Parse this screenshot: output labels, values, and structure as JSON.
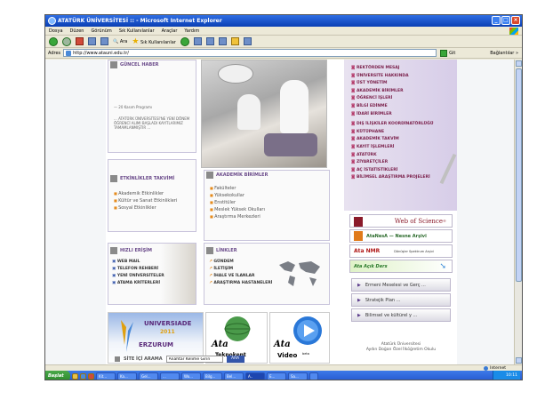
{
  "window": {
    "title": "ATATÜRK ÜNİVERSİTESİ :: - Microsoft Internet Explorer"
  },
  "menubar": {
    "items": [
      "Dosya",
      "Düzen",
      "Görünüm",
      "Sık Kullanılanlar",
      "Araçlar",
      "Yardım"
    ]
  },
  "toolbar": {
    "search_label": "Ara",
    "favorites_label": "Sık Kullanılanlar"
  },
  "addressbar": {
    "label": "Adres",
    "url": "http://www.atauni.edu.tr/",
    "go_label": "Git",
    "links_label": "Bağlantılar »"
  },
  "page": {
    "guncel": {
      "title": "GÜNCEL HABER",
      "news_text_1": "— 20 Kasım Programı",
      "news_text_2": "... ATATÜRK ÜNİVERSİTESİ'NE YENİ DÖNEM ÖĞRENCİ ALIMI BAŞLADI KAYITLARIMIZ TAMAMLANMIŞTIR ..."
    },
    "etkinlikler": {
      "title": "ETKİNLİKLER TAKVİMİ",
      "items": [
        "Akademik Etkinlikler",
        "Kültür ve Sanat Etkinlikleri",
        "Sosyal Etkinlikler"
      ]
    },
    "akademik": {
      "title": "AKADEMİK BİRİMLER",
      "items": [
        "Fakülteler",
        "Yüksekokullar",
        "Enstitüler",
        "Meslek Yüksek Okulları",
        "Araştırma Merkezleri"
      ]
    },
    "hizli": {
      "title": "HIZLI ERİŞİM",
      "items": [
        "WEB MAIL",
        "TELEFON REHBERİ",
        "YENİ ÜNİVERSİTELER",
        "ATAMA KRİTERLERİ"
      ]
    },
    "linkler": {
      "title": "LİNKLER",
      "items": [
        "GÜNDEM",
        "İLETİŞİM",
        "İHALE VE İLANLAR",
        "ARAŞTIRMA HASTANELERİ"
      ]
    },
    "rightmenu": {
      "items": [
        "REKTÖRDEN MESAJ",
        "ÜNİVERSİTE HAKKINDA",
        "ÜST YÖNETİM",
        "AKADEMİK BİRİMLER",
        "ÖĞRENCİ İŞLERİ",
        "BİLGİ EDİNME",
        "İDARİ BİRİMLER",
        "DIŞ İLİŞKİLER KOORDİNATÖRLÜĞÜ",
        "KÜTÜPHANE",
        "AKADEMİK TAKVİM",
        "KAYIT İŞLEMLERİ",
        "ATATÜRK",
        "ZİYARETÇİLER",
        "AÇ İSTATİSTİKLERİ",
        "BİLİMSEL ARAŞTIRMA PROJELERİ"
      ]
    },
    "badges": {
      "wos": "Web of Science",
      "wos_sup": "®",
      "ata_nesa": "AtaNesA — Nesne Arşivi",
      "ata_nmr": "Ata NMR",
      "ata_nmr_sub": "Dönüşler Spektrum Arşivi",
      "ata_aqik": "Ata Açık Ders"
    },
    "nav_buttons": [
      "Ermeni Meselesi ve Gerç ...",
      "Stratejik Plan ...",
      "Bilimsel ve kültürel y ..."
    ],
    "logos": {
      "universiade_title": "UNIVERSIADE",
      "universiade_year": "2011",
      "universiade_city": "ERZURUM",
      "teknokent_a": "Ata",
      "teknokent_b": "Teknokent",
      "video_a": "Ata",
      "video_b": "Video",
      "video_sup": "beta"
    },
    "footer": {
      "line1": "Atatürk Üniversitesi",
      "line2": "Aydın Doğan Özel İlköğretim Okulu"
    },
    "search": {
      "label": "SİTE İÇİ ARAMA",
      "value": "Anahtar Kelime Girin",
      "button": "ARA"
    }
  },
  "statusbar": {
    "left": "",
    "zone": "Internet"
  },
  "taskbar": {
    "start": "Başlat",
    "tasks": [
      "Kit...",
      "Ka...",
      "Gel...",
      "...",
      "Wo...",
      "Bilg...",
      "Bel...",
      "A..",
      "E...",
      "Sa...",
      ""
    ],
    "clock": "10:11"
  },
  "colors": {
    "titlebar": "#0a3fb4",
    "accent_purple": "#6a4a8a",
    "menu_red": "#7a1f4a",
    "bullet_orange": "#e58a1c"
  }
}
